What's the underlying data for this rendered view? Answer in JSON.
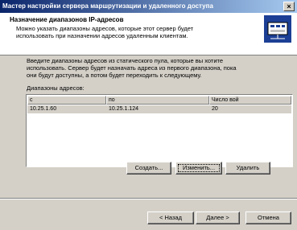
{
  "window": {
    "title": "Мастер настройки сервера маршрутизации и удаленного доступа",
    "close_label": "×"
  },
  "header": {
    "title": "Назначение диапазонов IP-адресов",
    "subtitle": "Можно указать диапазоны адресов, которые этот сервер будет\nиспользовать при назначении адресов удаленным клиентам."
  },
  "body": {
    "instruction": "Введите диапазоны адресов из статического пула, которые вы хотите\nиспользовать. Сервер будет назначать адреса из первого диапазона, пока\nони будут доступны, а потом будет переходить к следующему.",
    "list_label": "Диапазоны адресов:",
    "columns": [
      "с",
      "по",
      "Число вой"
    ],
    "rows": [
      {
        "from": "10.25.1.60",
        "to": "10.25.1.124",
        "count": "20"
      }
    ]
  },
  "buttons": {
    "create": "Создать...",
    "edit": "Изменить...",
    "delete": "Удалить",
    "back": "< Назад",
    "next": "Далее >",
    "cancel": "Отмена"
  }
}
